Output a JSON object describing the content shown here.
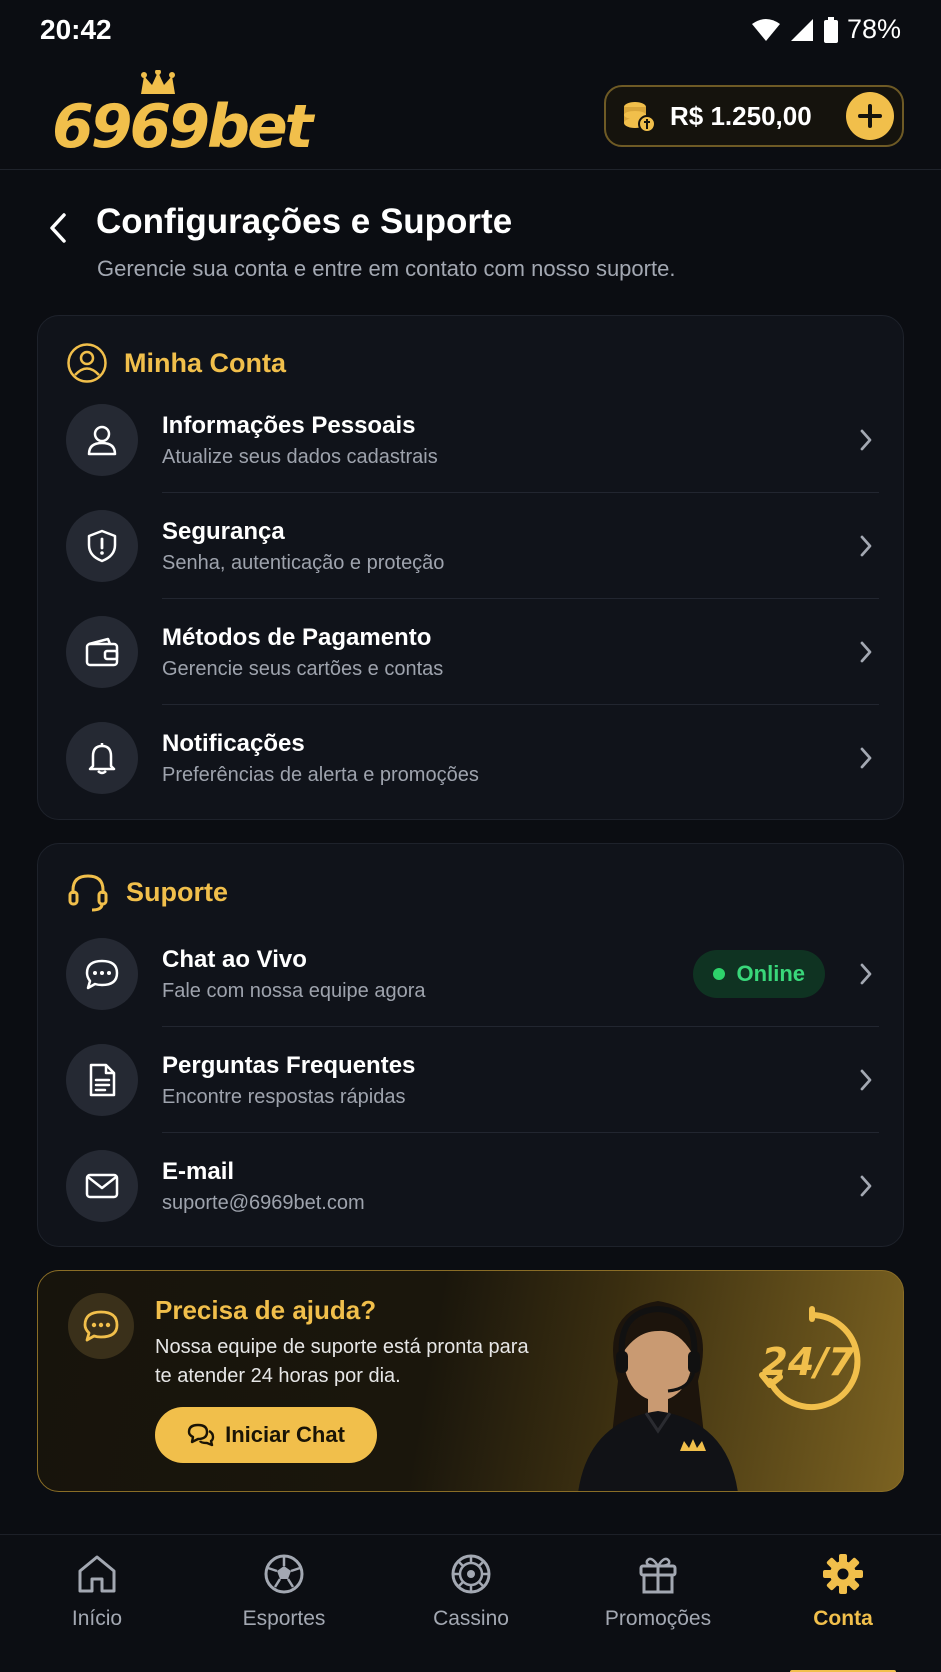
{
  "status_bar": {
    "time": "20:42",
    "battery": "78%"
  },
  "header": {
    "brand": "6969bet",
    "balance": "R$ 1.250,00"
  },
  "page": {
    "title": "Configurações e Suporte",
    "subtitle": "Gerencie sua conta e entre em contato com nosso suporte."
  },
  "account_section": {
    "title": "Minha Conta",
    "items": [
      {
        "title": "Informações Pessoais",
        "subtitle": "Atualize seus dados cadastrais",
        "icon": "user-icon"
      },
      {
        "title": "Segurança",
        "subtitle": "Senha, autenticação e proteção",
        "icon": "shield-icon"
      },
      {
        "title": "Métodos de Pagamento",
        "subtitle": "Gerencie seus cartões e contas",
        "icon": "wallet-icon"
      },
      {
        "title": "Notificações",
        "subtitle": "Preferências de alerta e promoções",
        "icon": "bell-icon"
      }
    ]
  },
  "support_section": {
    "title": "Suporte",
    "items": [
      {
        "title": "Chat ao Vivo",
        "subtitle": "Fale com nossa equipe agora",
        "icon": "chat-icon",
        "badge": "Online"
      },
      {
        "title": "Perguntas Frequentes",
        "subtitle": "Encontre respostas rápidas",
        "icon": "document-icon"
      },
      {
        "title": "E-mail",
        "subtitle": "suporte@6969bet.com",
        "icon": "mail-icon"
      }
    ]
  },
  "help_banner": {
    "title": "Precisa de ajuda?",
    "text": "Nossa equipe de suporte está pronta para te atender 24 horas por dia.",
    "button": "Iniciar Chat",
    "badge": "24/7"
  },
  "bottom_nav": [
    {
      "label": "Início",
      "icon": "home-icon",
      "active": false
    },
    {
      "label": "Esportes",
      "icon": "soccer-ball-icon",
      "active": false
    },
    {
      "label": "Cassino",
      "icon": "roulette-icon",
      "active": false
    },
    {
      "label": "Promoções",
      "icon": "gift-icon",
      "active": false
    },
    {
      "label": "Conta",
      "icon": "gear-icon",
      "active": true
    }
  ],
  "colors": {
    "accent": "#f1bf4b",
    "background": "#0b0d12",
    "online": "#2ed36b"
  }
}
